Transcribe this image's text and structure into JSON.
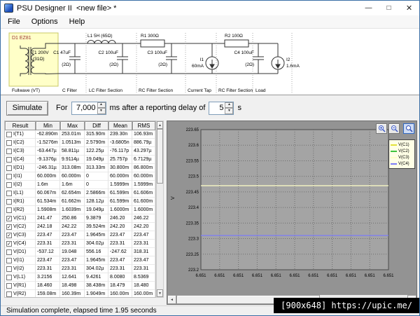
{
  "window": {
    "title": "PSU Designer II  <new file> *",
    "controls": {
      "minimize_glyph": "—",
      "maximize_glyph": "□",
      "close_glyph": "✕"
    }
  },
  "menu": {
    "items": [
      "File",
      "Options",
      "Help"
    ]
  },
  "schematic": {
    "labels": {
      "d1": "D1 EZ81",
      "t1": "T1 200V",
      "t1_imp": "(31Ω)",
      "c1": "C1 47uF",
      "c1_esr": "(2Ω)",
      "l1": "L1 5H (65Ω)",
      "c2": "C2 100uF",
      "c2_esr": "(2Ω)",
      "r1": "R1 300Ω",
      "c3": "C3 100uF",
      "c3_esr": "(2Ω)",
      "i1": "I1",
      "i1_val": "60mA",
      "r2": "R2 100Ω",
      "c4": "C4 100uF",
      "c4_esr": "(2Ω)",
      "i2": "I2",
      "i2_val": "1.6mA"
    },
    "sections": [
      "Fullwave (VT)",
      "C Filter",
      "LC Filter Section",
      "RC Filter Section",
      "Current Tap",
      "RC Filter Section",
      "Load"
    ]
  },
  "simbar": {
    "simulate_label": "Simulate",
    "for_label": "For",
    "duration_value": "7,000",
    "after_label": "ms after a reporting delay of",
    "delay_value": "5",
    "unit_label": "s"
  },
  "results": {
    "headers": [
      "Result",
      "Min",
      "Max",
      "Diff",
      "Mean",
      "RMS"
    ],
    "check_glyph": "✓",
    "rows": [
      {
        "checked": false,
        "label": "I(T1)",
        "min": "-62.890m",
        "max": "253.01m",
        "diff": "315.90m",
        "mean": "239.30n",
        "rms": "106.93m"
      },
      {
        "checked": false,
        "label": "I(C2)",
        "min": "-1.5276m",
        "max": "1.0513m",
        "diff": "2.5790m",
        "mean": "-3.6805n",
        "rms": "886.79µ"
      },
      {
        "checked": false,
        "label": "I(C3)",
        "min": "-63.447µ",
        "max": "58.811µ",
        "diff": "122.25µ",
        "mean": "-76.117p",
        "rms": "43.297µ"
      },
      {
        "checked": false,
        "label": "I(C4)",
        "min": "-9.1376µ",
        "max": "9.9114µ",
        "diff": "19.049µ",
        "mean": "25.757p",
        "rms": "6.7129µ"
      },
      {
        "checked": false,
        "label": "I(D1)",
        "min": "-246.31µ",
        "max": "313.08m",
        "diff": "313.33m",
        "mean": "30.800m",
        "rms": "86.800m"
      },
      {
        "checked": false,
        "label": "I(I1)",
        "min": "60.000m",
        "max": "60.000m",
        "diff": "0",
        "mean": "60.000m",
        "rms": "60.000m"
      },
      {
        "checked": false,
        "label": "I(I2)",
        "min": "1.6m",
        "max": "1.6m",
        "diff": "0",
        "mean": "1.5999m",
        "rms": "1.5999m"
      },
      {
        "checked": false,
        "label": "I(L1)",
        "min": "60.067m",
        "max": "62.654m",
        "diff": "2.5866m",
        "mean": "61.599m",
        "rms": "61.606m"
      },
      {
        "checked": false,
        "label": "I(R1)",
        "min": "61.534m",
        "max": "61.662m",
        "diff": "128.12µ",
        "mean": "61.599m",
        "rms": "61.600m"
      },
      {
        "checked": false,
        "label": "I(R2)",
        "min": "1.5908m",
        "max": "1.6039m",
        "diff": "19.049µ",
        "mean": "1.6000m",
        "rms": "1.6000m"
      },
      {
        "checked": true,
        "label": "V(C1)",
        "min": "241.47",
        "max": "250.86",
        "diff": "9.3879",
        "mean": "246.20",
        "rms": "246.22"
      },
      {
        "checked": true,
        "label": "V(C2)",
        "min": "242.18",
        "max": "242.22",
        "diff": "39.524m",
        "mean": "242.20",
        "rms": "242.20"
      },
      {
        "checked": true,
        "label": "V(C3)",
        "min": "223.47",
        "max": "223.47",
        "diff": "1.9645m",
        "mean": "223.47",
        "rms": "223.47"
      },
      {
        "checked": true,
        "label": "V(C4)",
        "min": "223.31",
        "max": "223.31",
        "diff": "304.02µ",
        "mean": "223.31",
        "rms": "223.31"
      },
      {
        "checked": false,
        "label": "V(D1)",
        "min": "-537.12",
        "max": "19.048",
        "diff": "556.16",
        "mean": "-247.62",
        "rms": "318.31"
      },
      {
        "checked": false,
        "label": "V(I1)",
        "min": "223.47",
        "max": "223.47",
        "diff": "1.9645m",
        "mean": "223.47",
        "rms": "223.47"
      },
      {
        "checked": false,
        "label": "V(I2)",
        "min": "223.31",
        "max": "223.31",
        "diff": "304.02µ",
        "mean": "223.31",
        "rms": "223.31"
      },
      {
        "checked": false,
        "label": "V(L1)",
        "min": "3.2156",
        "max": "12.641",
        "diff": "9.4261",
        "mean": "8.0080",
        "rms": "8.5369"
      },
      {
        "checked": false,
        "label": "V(R1)",
        "min": "18.460",
        "max": "18.498",
        "diff": "38.438m",
        "mean": "18.479",
        "rms": "18.480"
      },
      {
        "checked": false,
        "label": "V(R2)",
        "min": "159.08m",
        "max": "160.39m",
        "diff": "1.9049m",
        "mean": "160.00m",
        "rms": "160.00m"
      }
    ]
  },
  "chart": {
    "icons": {
      "zoom_in": "magnifier-plus",
      "zoom_out": "magnifier-minus",
      "zoom_extents": "magnifier"
    }
  },
  "chart_data": {
    "type": "line",
    "title": "",
    "xlabel": "",
    "ylabel": "V",
    "ylim": [
      223.2,
      223.65
    ],
    "y_ticks": [
      "223.65",
      "223.6",
      "223.55",
      "223.5",
      "223.45",
      "223.4",
      "223.35",
      "223.3",
      "223.25",
      "223.2"
    ],
    "x_tick_label": "6.651",
    "x_tick_count": 11,
    "grid": "dotted",
    "legend_position": "right",
    "series": [
      {
        "name": "V(C1)",
        "color": "#e2e23a",
        "value": 246.2
      },
      {
        "name": "V(C2)",
        "color": "#3ec43e",
        "value": 242.2
      },
      {
        "name": "V(C3)",
        "color": "#ffffc8",
        "value": 223.47
      },
      {
        "name": "V(C4)",
        "color": "#7c7cf8",
        "value": 223.31
      }
    ]
  },
  "status": {
    "text": "Simulation complete, elapsed time 1.95 seconds"
  },
  "watermark": {
    "text": "[900x648] https://upic.me/"
  }
}
